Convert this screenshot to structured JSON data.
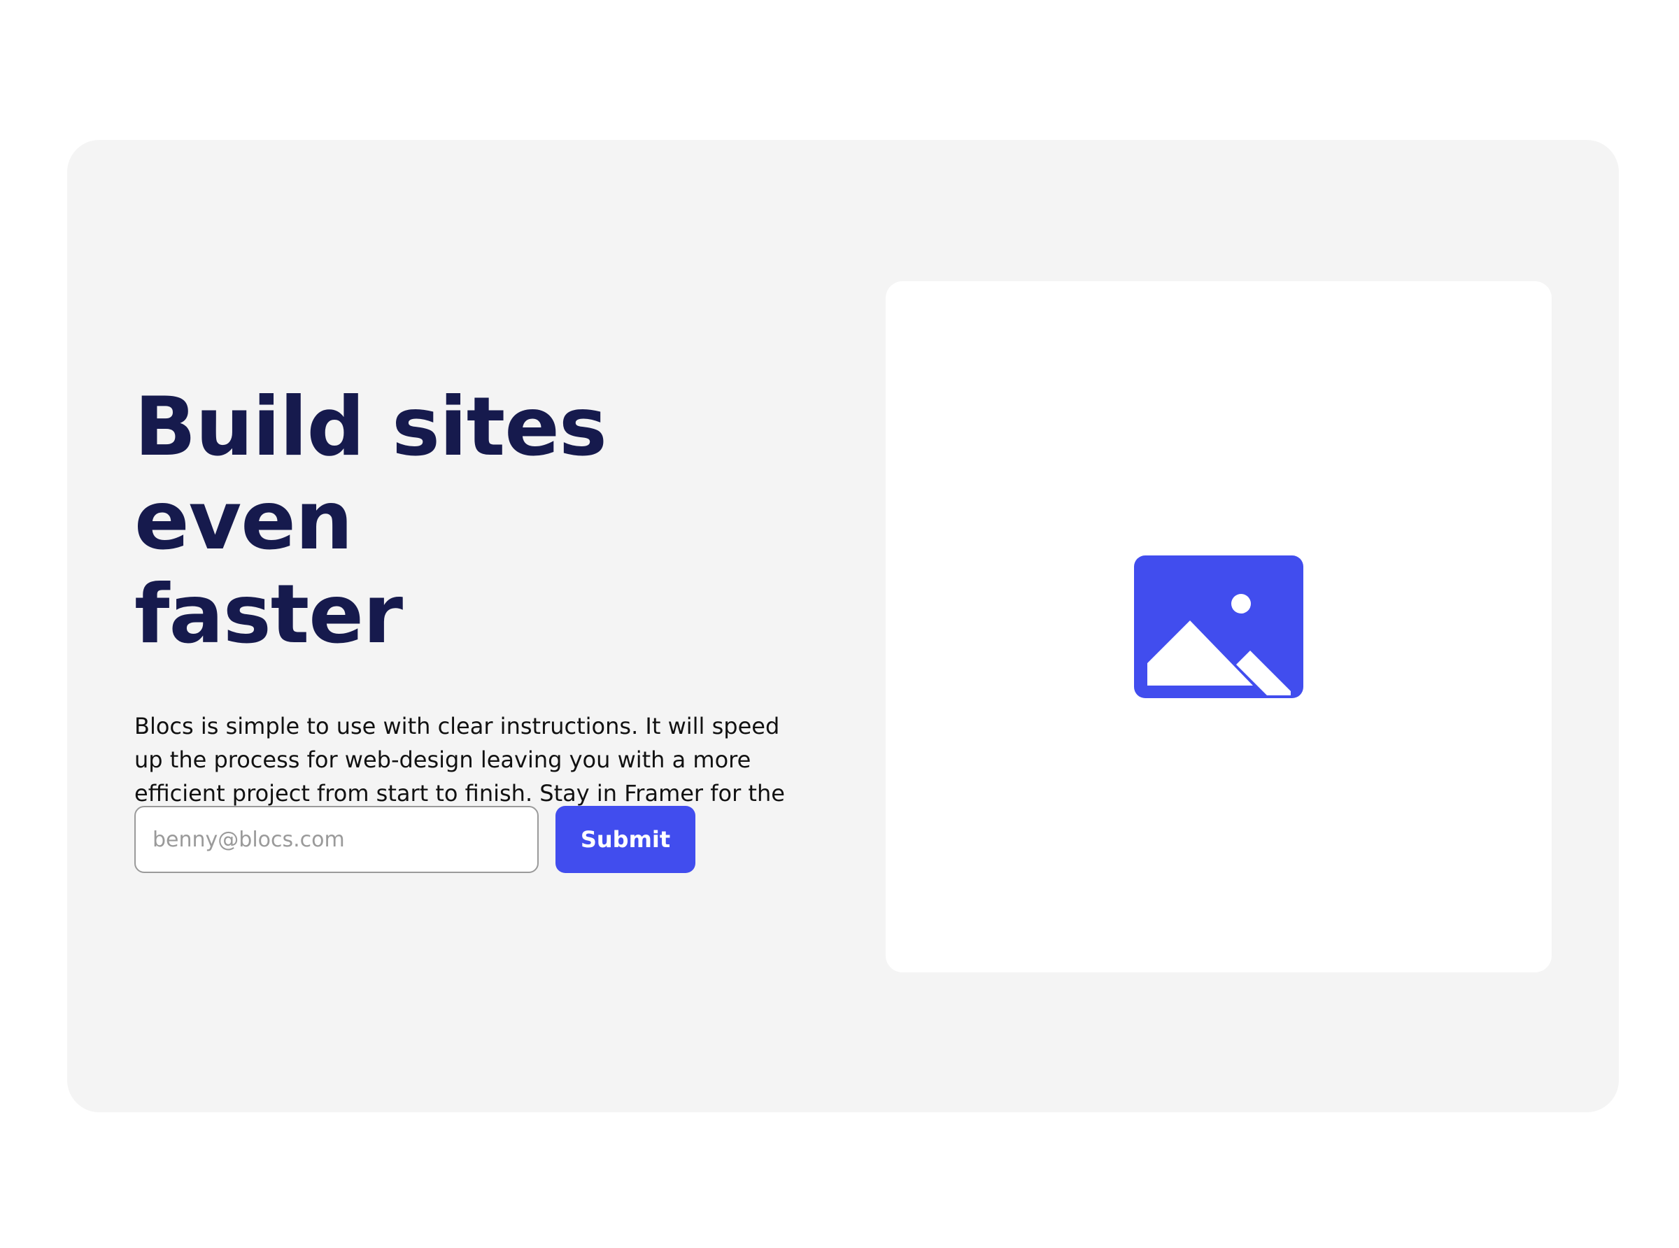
{
  "hero": {
    "headline_line1": "Build sites even",
    "headline_line2": "faster",
    "description": "Blocs is simple to use with clear instructions. It will speed up the process for web-design leaving you with a more efficient project from start to finish. Stay in Framer for the whole process",
    "email_placeholder": "benny@blocs.com",
    "submit_label": "Submit",
    "image_icon": "image-placeholder-icon"
  },
  "colors": {
    "page_background": "#ffffff",
    "card_background": "#f4f4f4",
    "headline": "#161a4d",
    "accent": "#414dee",
    "input_border": "#9a9a9a"
  }
}
